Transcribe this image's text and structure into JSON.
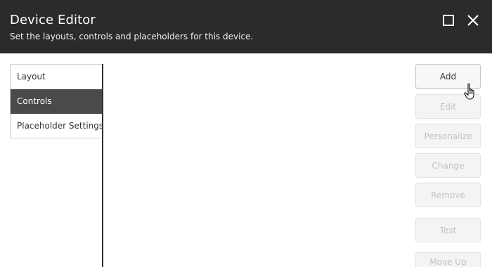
{
  "dialog": {
    "title": "Device Editor",
    "subtitle": "Set the layouts, controls and placeholders for this device.",
    "maximize_icon": "maximize-icon",
    "close_icon": "close-icon",
    "header_color": "#2b2b2b"
  },
  "sidebar": {
    "items": [
      {
        "label": "Layout",
        "active": false
      },
      {
        "label": "Controls",
        "active": true
      },
      {
        "label": "Placeholder Settings",
        "active": false
      }
    ],
    "active_color": "#4a4a4a"
  },
  "actions": {
    "add": "Add",
    "edit": "Edit",
    "personalize": "Personalize",
    "change": "Change",
    "remove": "Remove",
    "test": "Test",
    "move_up": "Move Up"
  },
  "cursor_icon": "hand-pointer-icon"
}
